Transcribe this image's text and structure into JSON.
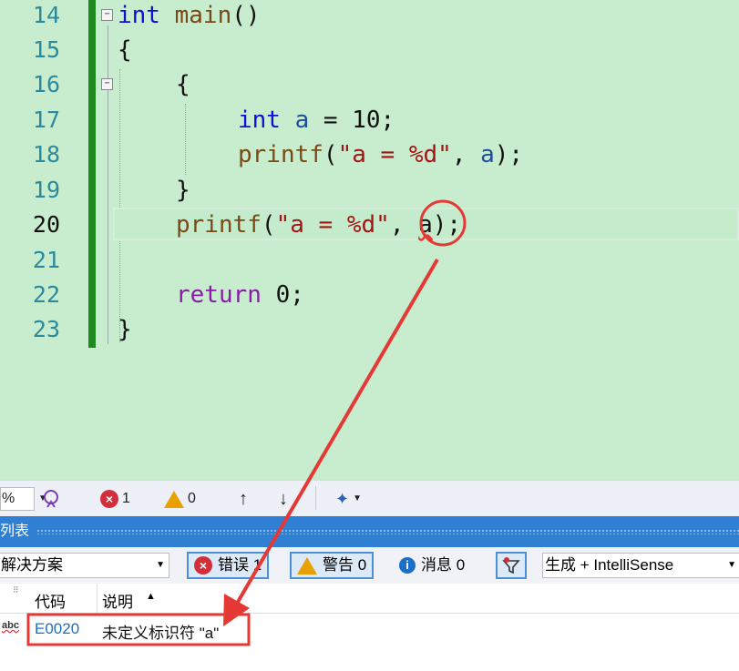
{
  "editor": {
    "lines": [
      {
        "num": "14"
      },
      {
        "num": "15"
      },
      {
        "num": "16"
      },
      {
        "num": "17"
      },
      {
        "num": "18"
      },
      {
        "num": "19"
      },
      {
        "num": "20"
      },
      {
        "num": "21"
      },
      {
        "num": "22"
      },
      {
        "num": "23"
      }
    ],
    "tokens": {
      "l14_kw": "int",
      "l14_fn": "main",
      "l14_rest": "()",
      "l15": "{",
      "l16": "{",
      "l17_kw": "int",
      "l17_var": "a",
      "l17_rest": " = 10;",
      "l18_fn": "printf",
      "l18_p": "(",
      "l18_str": "\"a = %d\"",
      "l18_c": ", ",
      "l18_var": "a",
      "l18_e": ");",
      "l19": "}",
      "l20_fn": "printf",
      "l20_p": "(",
      "l20_str": "\"a = %d\"",
      "l20_c": ", ",
      "l20_var": "a",
      "l20_e": ");",
      "l22_kw": "return",
      "l22_rest": " 0;",
      "l23": "}"
    },
    "fold_glyph": "−"
  },
  "toolbar": {
    "zoom": "%",
    "error_count": "1",
    "warning_count": "0",
    "up_arrow": "↑",
    "down_arrow": "↓"
  },
  "panel": {
    "title": "列表"
  },
  "filter": {
    "scope": "解决方案",
    "errors_label": "错误 1",
    "warnings_label": "警告 0",
    "messages_label": "消息 0",
    "build_source": "生成 + IntelliSense"
  },
  "list": {
    "col_code": "代码",
    "col_desc": "说明",
    "rows": [
      {
        "code": "E0020",
        "desc": "未定义标识符 \"a\"",
        "icon_text": "abc"
      }
    ]
  },
  "colors": {
    "editor_bg": "#c7ecce",
    "annotation": "#e53935",
    "keyword": "#1010d0",
    "string": "#a31515",
    "error_code": "#1a6fc8"
  }
}
